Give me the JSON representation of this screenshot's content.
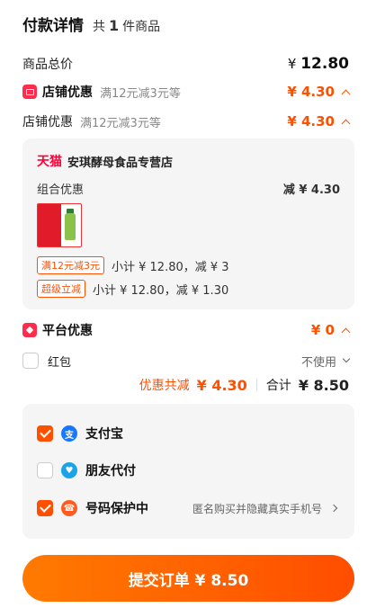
{
  "header": {
    "title": "付款详情",
    "count_prefix": "共",
    "count": "1",
    "count_suffix": "件商品"
  },
  "goods_total": {
    "label": "商品总价",
    "currency": "¥",
    "amount": "12.80"
  },
  "shop_discount": {
    "label": "店铺优惠",
    "rule": "满12元减3元等",
    "amount": "¥ 4.30"
  },
  "shop_discount_detail": {
    "label": "店铺优惠",
    "rule": "满12元减3元等",
    "amount": "¥ 4.30"
  },
  "store": {
    "brand": "天猫",
    "name": "安琪酵母食品专营店",
    "combo_label": "组合优惠",
    "combo_value": "减 ¥ 4.30",
    "promos": [
      {
        "tag": "满12元减3元",
        "text": "小计 ¥ 12.80，减 ¥ 3"
      },
      {
        "tag": "超级立减",
        "text": "小计 ¥ 12.80，减 ¥ 1.30"
      }
    ]
  },
  "platform_discount": {
    "label": "平台优惠",
    "amount": "¥ 0"
  },
  "red_packet": {
    "label": "红包",
    "value": "不使用"
  },
  "summary": {
    "discount_label": "优惠共减",
    "discount_amount": "¥ 4.30",
    "total_label": "合计",
    "total_amount": "¥ 8.50"
  },
  "payments": [
    {
      "label": "支付宝",
      "checked": true,
      "icon": "alipay-icon",
      "color": "#1677ff",
      "glyph": "支"
    },
    {
      "label": "朋友代付",
      "checked": false,
      "icon": "friend-pay-icon",
      "color": "#1aa3e8",
      "glyph": "♥"
    },
    {
      "label": "号码保护中",
      "checked": true,
      "icon": "phone-protect-icon",
      "color": "#ff5a1f",
      "glyph": "☎",
      "desc": "匿名购买并隐藏真实手机号"
    }
  ],
  "submit": {
    "label": "提交订单 ¥ 8.50"
  },
  "colors": {
    "accent": "#ff5000",
    "brand_red": "#ff0036"
  }
}
